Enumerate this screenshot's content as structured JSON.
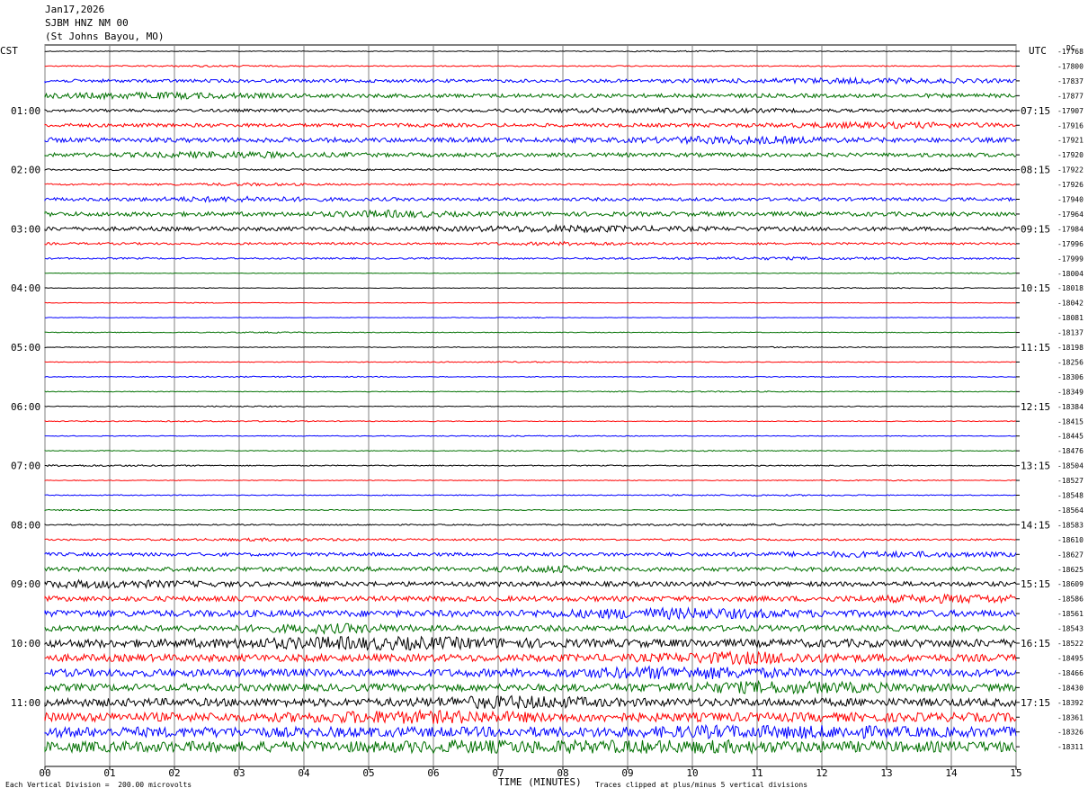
{
  "header": {
    "date": "Jan17,2026",
    "station": "SJBM HNZ NM 00",
    "location": "(St Johns Bayou, MO)"
  },
  "left_axis_title": "CST",
  "right_axis_title": "UTC",
  "dc_label": "DC",
  "footer": {
    "scale_note": "Each Vertical Division =  200.00 microvolts",
    "xlabel": "TIME (MINUTES)",
    "clip_note": "Traces clipped at plus/minus 5 vertical divisions"
  },
  "chart_data": {
    "type": "line",
    "title": "",
    "xlabel": "TIME (MINUTES)",
    "xlim": [
      0,
      15
    ],
    "x_ticks": [
      "00",
      "01",
      "02",
      "03",
      "04",
      "05",
      "06",
      "07",
      "08",
      "09",
      "10",
      "11",
      "12",
      "13",
      "14",
      "15"
    ],
    "row_minutes": 15,
    "trace_colors": [
      "#000000",
      "#ff0000",
      "#0000ff",
      "#007000"
    ],
    "cst_hour_labels": [
      "01:00",
      "02:00",
      "03:00",
      "04:00",
      "05:00",
      "06:00",
      "07:00",
      "08:00",
      "09:00",
      "10:00",
      "11:00"
    ],
    "utc_hour_labels": [
      "07:15",
      "08:15",
      "09:15",
      "10:15",
      "11:15",
      "12:15",
      "13:15",
      "14:15",
      "15:15",
      "16:15",
      "17:15"
    ],
    "dc_offsets": [
      -17768,
      -17800,
      -17837,
      -17877,
      -17907,
      -17916,
      -17921,
      -17920,
      -17922,
      -17926,
      -17940,
      -17964,
      -17984,
      -17996,
      -17999,
      -18004,
      -18018,
      -18042,
      -18081,
      -18137,
      -18198,
      -18256,
      -18306,
      -18349,
      -18384,
      -18415,
      -18445,
      -18476,
      -18504,
      -18527,
      -18548,
      -18564,
      -18583,
      -18610,
      -18627,
      -18625,
      -18609,
      -18586,
      -18561,
      -18543,
      -18522,
      -18495,
      -18466,
      -18430,
      -18392,
      -18361,
      -18326,
      -18311
    ],
    "noise_levels": [
      0.4,
      0.6,
      1.8,
      2.2,
      1.6,
      2.0,
      2.6,
      2.2,
      0.9,
      1.0,
      1.8,
      2.4,
      2.2,
      1.2,
      0.9,
      0.3,
      0.3,
      0.3,
      0.3,
      0.4,
      0.4,
      0.4,
      0.4,
      0.4,
      0.4,
      0.4,
      0.4,
      0.4,
      0.6,
      0.4,
      0.5,
      0.5,
      0.7,
      1.0,
      1.9,
      2.4,
      2.6,
      2.8,
      3.6,
      3.2,
      4.4,
      4.0,
      4.2,
      4.0,
      4.4,
      5.0,
      5.6,
      6.0
    ]
  }
}
